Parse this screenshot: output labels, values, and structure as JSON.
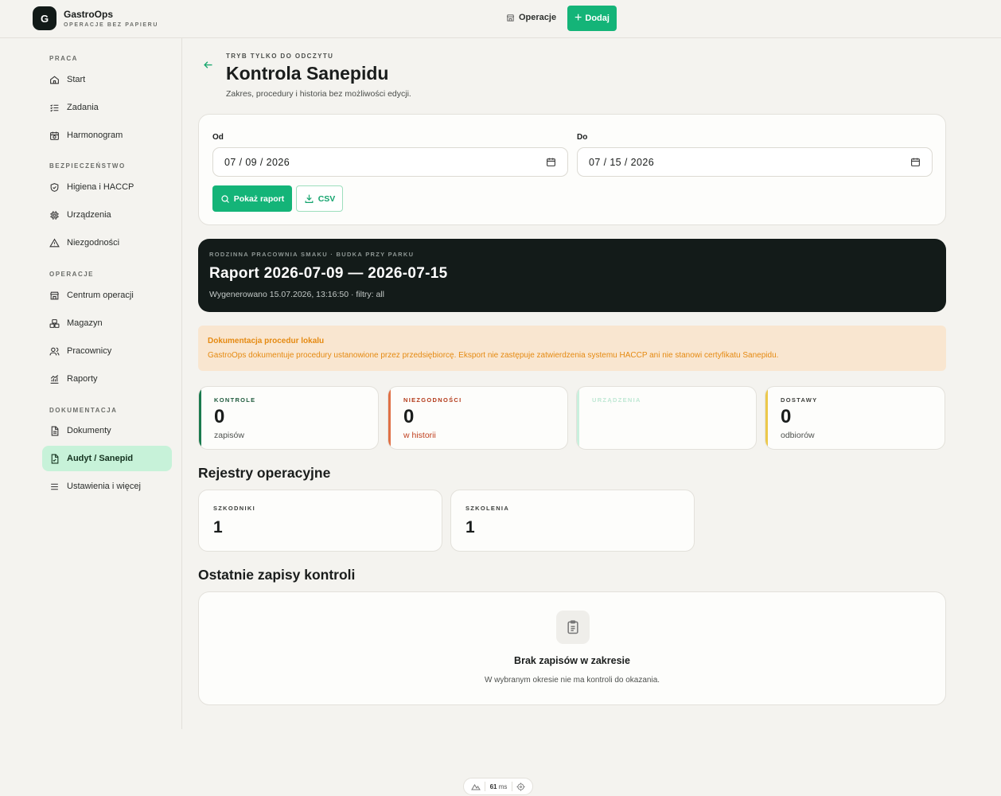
{
  "header": {
    "logo_letter": "G",
    "brand_name": "GastroOps",
    "brand_tagline": "OPERACJE BEZ PAPIERU",
    "nav_operations": "Operacje",
    "add_button": "Dodaj"
  },
  "sidebar": {
    "sections": [
      {
        "title": "PRACA",
        "items": [
          {
            "label": "Start",
            "icon": "home-icon"
          },
          {
            "label": "Zadania",
            "icon": "checklist-icon"
          },
          {
            "label": "Harmonogram",
            "icon": "calendar-clock-icon"
          }
        ]
      },
      {
        "title": "BEZPIECZEŃSTWO",
        "items": [
          {
            "label": "Higiena i HACCP",
            "icon": "shield-check-icon"
          },
          {
            "label": "Urządzenia",
            "icon": "chip-icon"
          },
          {
            "label": "Niezgodności",
            "icon": "warning-icon"
          }
        ]
      },
      {
        "title": "OPERACJE",
        "items": [
          {
            "label": "Centrum operacji",
            "icon": "store-icon"
          },
          {
            "label": "Magazyn",
            "icon": "boxes-icon"
          },
          {
            "label": "Pracownicy",
            "icon": "users-icon"
          },
          {
            "label": "Raporty",
            "icon": "chart-icon"
          }
        ]
      },
      {
        "title": "DOKUMENTACJA",
        "items": [
          {
            "label": "Dokumenty",
            "icon": "document-icon"
          },
          {
            "label": "Audyt / Sanepid",
            "icon": "file-check-icon",
            "active": true
          },
          {
            "label": "Ustawienia i więcej",
            "icon": "menu-icon"
          }
        ]
      }
    ]
  },
  "page": {
    "eyebrow": "TRYB TYLKO DO ODCZYTU",
    "title": "Kontrola Sanepidu",
    "subtitle": "Zakres, procedury i historia bez możliwości edycji."
  },
  "filters": {
    "from_label": "Od",
    "from_value": "07 / 09 / 2026",
    "to_label": "Do",
    "to_value": "07 / 15 / 2026",
    "show_report_button": "Pokaż raport",
    "csv_button": "CSV"
  },
  "report": {
    "meta": "RODZINNA PRACOWNIA SMAKU · BUDKA PRZY PARKU",
    "title": "Raport 2026-07-09 — 2026-07-15",
    "generated": "Wygenerowano 15.07.2026, 13:16:50 · filtry: all"
  },
  "notice": {
    "title": "Dokumentacja procedur lokalu",
    "text": "GastroOps dokumentuje procedury ustanowione przez przedsiębiorcę. Eksport nie zastępuje zatwierdzenia systemu HACCP ani nie stanowi certyfikatu Sanepidu."
  },
  "stats": [
    {
      "label": "KONTROLE",
      "value": "0",
      "unit": "zapisów",
      "color": "#1a7a4e"
    },
    {
      "label": "NIEZGODNOŚCI",
      "value": "0",
      "unit": "w historii",
      "color": "#e07045"
    },
    {
      "label": "URZĄDZENIA",
      "value": "",
      "unit": "",
      "color": "#b6ecd3"
    },
    {
      "label": "DOSTAWY",
      "value": "0",
      "unit": "odbiorów",
      "color": "#ecc84a"
    }
  ],
  "registers": {
    "heading": "Rejestry operacyjne",
    "items": [
      {
        "label": "SZKODNIKI",
        "value": "1"
      },
      {
        "label": "SZKOLENIA",
        "value": "1"
      }
    ]
  },
  "recent": {
    "heading": "Ostatnie zapisy kontroli",
    "empty_title": "Brak zapisów w zakresie",
    "empty_text": "W wybranym okresie nie ma kontroli do okazania."
  },
  "perf": {
    "value": "61",
    "unit": "ms"
  }
}
